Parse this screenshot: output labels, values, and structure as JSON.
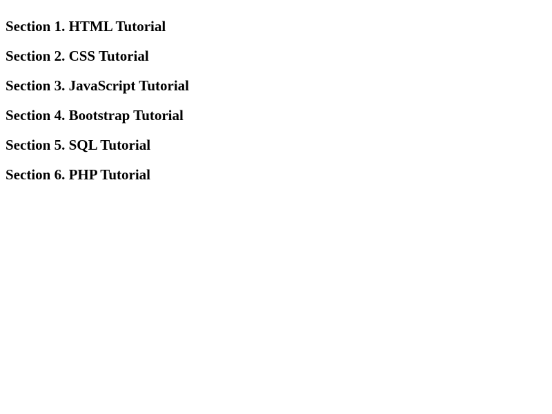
{
  "sections": [
    {
      "label": "Section 1. HTML Tutorial"
    },
    {
      "label": "Section 2. CSS Tutorial"
    },
    {
      "label": "Section 3. JavaScript Tutorial"
    },
    {
      "label": "Section 4. Bootstrap Tutorial"
    },
    {
      "label": "Section 5. SQL Tutorial"
    },
    {
      "label": "Section 6. PHP Tutorial"
    }
  ]
}
